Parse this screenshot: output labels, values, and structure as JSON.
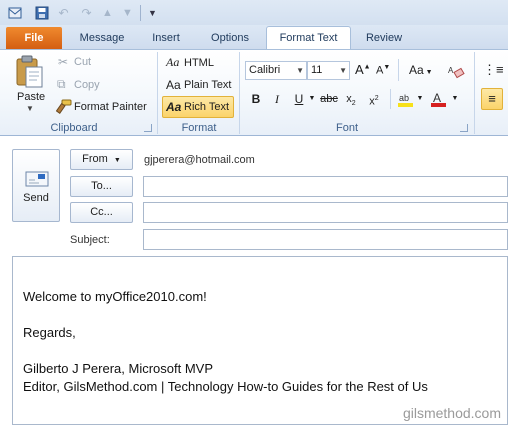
{
  "tabs": {
    "file": "File",
    "message": "Message",
    "insert": "Insert",
    "options": "Options",
    "format_text": "Format Text",
    "review": "Review"
  },
  "clipboard": {
    "paste": "Paste",
    "cut": "Cut",
    "copy": "Copy",
    "format_painter": "Format Painter",
    "label": "Clipboard"
  },
  "format": {
    "html": "HTML",
    "plain_text": "Plain Text",
    "rich_text": "Rich Text",
    "label": "Format"
  },
  "font": {
    "family": "Calibri",
    "size": "11",
    "label": "Font",
    "highlight_color": "#f7e11a",
    "font_color": "#d62020"
  },
  "compose": {
    "send": "Send",
    "from_button": "From",
    "from_value": "gjperera@hotmail.com",
    "to_button": "To...",
    "cc_button": "Cc...",
    "subject_label": "Subject:"
  },
  "body": {
    "line1": "Welcome to myOffice2010.com!",
    "line2": "Regards,",
    "line3": "Gilberto J Perera, Microsoft MVP",
    "line4": "Editor, GilsMethod.com | Technology How-to Guides for the Rest of Us"
  },
  "watermark": "gilsmethod.com"
}
